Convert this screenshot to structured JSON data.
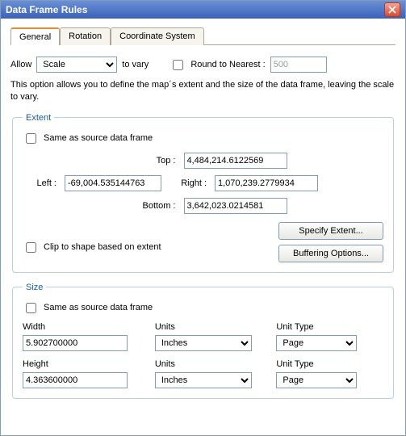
{
  "window": {
    "title": "Data Frame Rules"
  },
  "tabs": {
    "general": "General",
    "rotation": "Rotation",
    "coord": "Coordinate System"
  },
  "allow": {
    "label": "Allow",
    "value": "Scale",
    "suffix": "to vary",
    "round_label": "Round to Nearest :",
    "round_value": "500"
  },
  "description": "This option allows you to define the map´s extent and the size of the data frame, leaving the scale to vary.",
  "extent": {
    "legend": "Extent",
    "same_label": "Same as source data frame",
    "top_label": "Top :",
    "top_value": "4,484,214.6122569",
    "left_label": "Left :",
    "left_value": "-69,004.535144763",
    "right_label": "Right :",
    "right_value": "1,070,239.2779934",
    "bottom_label": "Bottom :",
    "bottom_value": "3,642,023.0214581",
    "specify_btn": "Specify Extent...",
    "buffer_btn": "Buffering Options...",
    "clip_label": "Clip to shape based on extent"
  },
  "size": {
    "legend": "Size",
    "same_label": "Same as source data frame",
    "width_label": "Width",
    "width_value": "5.902700000",
    "height_label": "Height",
    "height_value": "4.363600000",
    "units_label": "Units",
    "units_value": "Inches",
    "unit_type_label": "Unit Type",
    "unit_type_value": "Page"
  }
}
